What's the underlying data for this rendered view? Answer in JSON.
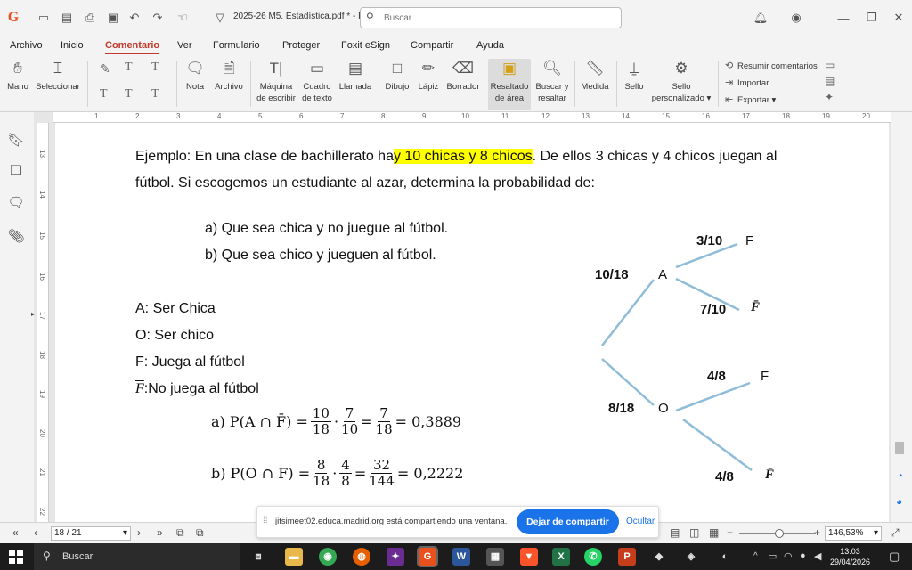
{
  "app": {
    "title": "2025-26 M5. Estadística.pdf * - F...",
    "search_placeholder": "Buscar"
  },
  "menu": [
    "Archivo",
    "Inicio",
    "Comentario",
    "Ver",
    "Formulario",
    "Proteger",
    "Foxit eSign",
    "Compartir",
    "Ayuda"
  ],
  "ribbon": {
    "mano": "Mano",
    "seleccionar": "Seleccionar",
    "nota": "Nota",
    "archivo": "Archivo",
    "maquina1": "Máquina",
    "maquina2": "de escribir",
    "cuadro1": "Cuadro",
    "cuadro2": "de texto",
    "llamada": "Llamada",
    "dibujo": "Dibujo",
    "lapiz": "Lápiz",
    "borrador": "Borrador",
    "resaltado1": "Resaltado",
    "resaltado2": "de área",
    "buscar1": "Buscar y",
    "buscar2": "resaltar",
    "medida": "Medida",
    "sello": "Sello",
    "sello_p1": "Sello",
    "sello_p2": "personalizado",
    "resumir": "Resumir comentarios",
    "importar": "Importar",
    "exportar": "Exportar"
  },
  "ruler": [
    "1",
    "2",
    "3",
    "4",
    "5",
    "6",
    "7",
    "8",
    "9",
    "10",
    "11",
    "12",
    "13",
    "14",
    "15",
    "16",
    "17",
    "18",
    "19",
    "20"
  ],
  "vruler": [
    "13",
    "14",
    "15",
    "16",
    "17",
    "18",
    "19",
    "20",
    "21",
    "22"
  ],
  "doc": {
    "line1_a": "Ejemplo: En una clase de bachillerato ha",
    "line1_hl": "y 10 chicas y 8 chicos",
    "line1_b": ". De ellos 3 chicas y 4 chicos juegan al",
    "line2": "fútbol. Si escogemos un estudiante al azar, determina la probabilidad de:",
    "qa": "a) Que sea chica y no juegue al fútbol.",
    "qb": "b) Que sea chico y jueguen al fútbol.",
    "defA": "A: Ser Chica",
    "defO": "O: Ser chico",
    "defF": "F: Juega al fútbol",
    "defNF_sym": "F",
    "defNF": ":No juega al fútbol",
    "ansA": {
      "label": "a) P(A ∩ F̄) =",
      "f1n": "10",
      "f1d": "18",
      "dot": "·",
      "f2n": "7",
      "f2d": "10",
      "eq": "=",
      "f3n": "7",
      "f3d": "18",
      "res": "= 0,3889"
    },
    "ansB": {
      "label": "b) P(O ∩ F) =",
      "f1n": "8",
      "f1d": "18",
      "dot": "·",
      "f2n": "4",
      "f2d": "8",
      "eq": "=",
      "f3n": "32",
      "f3d": "144",
      "res": "= 0,2222"
    },
    "tree": {
      "pA": "10/18",
      "A": "A",
      "pAF": "3/10",
      "AF": "F",
      "pANF": "7/10",
      "ANF": "F̄",
      "pO": "8/18",
      "O": "O",
      "pOF": "4/8",
      "OF": "F",
      "pONF": "4/8",
      "ONF": "F̄"
    }
  },
  "status": {
    "page": "18 / 21",
    "zoom": "146,53%"
  },
  "share": {
    "text": "jitsimeet02.educa.madrid.org está compartiendo una ventana.",
    "button": "Dejar de compartir",
    "hide": "Ocultar"
  },
  "taskbar": {
    "search": "Buscar",
    "time": "13:03",
    "date": "29/04/2026"
  },
  "colors": {
    "accent": "#c0392b",
    "highlight": "#ffff00",
    "tree_line": "#8fbcd8",
    "share_button": "#1a73e8"
  }
}
